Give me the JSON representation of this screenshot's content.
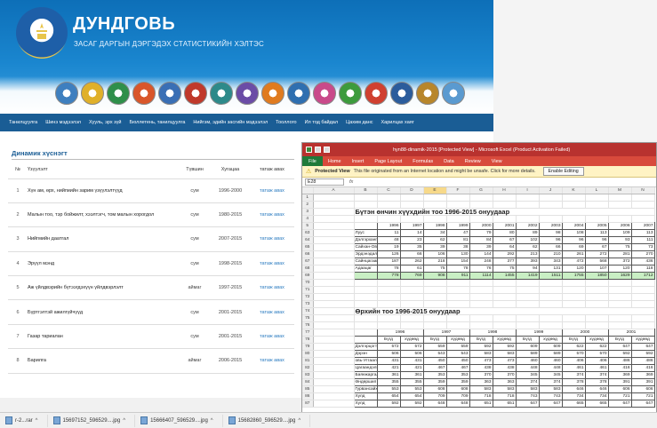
{
  "site": {
    "title": "ДУНДГОВЬ",
    "subtitle": "ЗАСАГ ДАРГЫН ДЭРГЭДЭХ СТАТИСТИКИЙН ХЭЛТЭС",
    "logo_colors": [
      "#3e7fbf",
      "#e0b02a",
      "#2f8f4a",
      "#d9562a",
      "#3a6fb5",
      "#c0392b",
      "#2d8a8a",
      "#6b4ca6",
      "#e07b1f",
      "#2f6fb0",
      "#c94a8a",
      "#3d9b3d",
      "#d04030",
      "#2b5c9c",
      "#b8862b",
      "#5a9ad0"
    ]
  },
  "nav": [
    "Танилцуулга",
    "Шинэ мэдээлэл",
    "Хууль, эрх зүй",
    "Бюллетень, танилцуулга",
    "Нийгэм, эдийн засгийн мэдээлэл",
    "Тооллого",
    "Ил тод байдал",
    "Цахим данс",
    "Харилцах хаяг"
  ],
  "dynamic": {
    "title": "Динамик хүснэгт",
    "headers": [
      "№",
      "Үзүүлэлт",
      "Түвшин",
      "Хугацаа",
      "татаж авах"
    ],
    "rows": [
      {
        "n": "1",
        "name": "Хүн ам, өрх, нийгмийн зарим үзүүлэлтүүд",
        "unit": "сум",
        "period": "1996-2000",
        "link": "татаж авах"
      },
      {
        "n": "2",
        "name": "Малын тоо, тэр бойжилт, хээлтэгч, том малын хорогдол",
        "unit": "сум",
        "period": "1980-2015",
        "link": "татаж авах"
      },
      {
        "n": "3",
        "name": "Нийгмийн даатгал",
        "unit": "сум",
        "period": "2007-2015",
        "link": "татаж авах"
      },
      {
        "n": "4",
        "name": "Эрүүл мэнд",
        "unit": "сум",
        "period": "1998-2015",
        "link": "татаж авах"
      },
      {
        "n": "5",
        "name": "Аж үйлдвэрийн бүтээгдэхүүн үйлдвэрлэлт",
        "unit": "аймаг",
        "period": "1997-2015",
        "link": "татаж авах"
      },
      {
        "n": "6",
        "name": "Бүртгэлтэй ажилгүйчүүд",
        "unit": "сум",
        "period": "2001-2015",
        "link": "татаж авах"
      },
      {
        "n": "7",
        "name": "Газар тариалан",
        "unit": "сум",
        "period": "2001-2015",
        "link": "татаж авах"
      },
      {
        "n": "8",
        "name": "Барилга",
        "unit": "аймаг",
        "period": "2006-2015",
        "link": "татаж авах"
      }
    ]
  },
  "excel": {
    "title": "hyn88-dinamik-2015 [Protected View] - Microsoft Excel (Product Activation Failed)",
    "file_tab": "File",
    "tabs": [
      "Home",
      "Insert",
      "Page Layout",
      "Formulas",
      "Data",
      "Review",
      "View"
    ],
    "protected_label": "Protected View",
    "protected_msg": "This file originated from an Internet location and might be unsafe. Click for more details.",
    "enable_btn": "Enable Editing",
    "cell_ref": "E28",
    "fx": "fx",
    "columns": [
      "A",
      "B",
      "C",
      "D",
      "E",
      "F",
      "G",
      "H",
      "I",
      "J",
      "K",
      "L",
      "M",
      "N"
    ],
    "heading1": "Бүтэн өнчин хүүхдийн тоо 1996-2015 онуудаар",
    "heading2": "Өрхийн тоо 1996-2015 онуудаар",
    "years1": [
      "1996",
      "1997",
      "1998",
      "1999",
      "2000",
      "2001",
      "2002",
      "2003",
      "2004",
      "2005",
      "2006",
      "2007",
      "2008"
    ],
    "table1": [
      {
        "r": "63",
        "name": "Луус",
        "v": [
          "11",
          "14",
          "34",
          "47",
          "79",
          "80",
          "89",
          "98",
          "108",
          "113",
          "109",
          "113",
          "120"
        ]
      },
      {
        "r": "64",
        "name": "Дэлгэрхангай",
        "v": [
          "48",
          "23",
          "62",
          "81",
          "84",
          "67",
          "102",
          "96",
          "96",
          "96",
          "93",
          "111",
          "126"
        ]
      },
      {
        "r": "65",
        "name": "Сайхан-Овоо",
        "v": [
          "19",
          "35",
          "39",
          "38",
          "39",
          "64",
          "62",
          "66",
          "69",
          "67",
          "75",
          "73",
          "24"
        ]
      },
      {
        "r": "66",
        "name": "Эрдэнэдалай",
        "v": [
          "126",
          "66",
          "106",
          "130",
          "144",
          "292",
          "213",
          "210",
          "261",
          "272",
          "281",
          "270",
          "261"
        ]
      },
      {
        "r": "67",
        "name": "Сайнцагаан",
        "v": [
          "187",
          "262",
          "218",
          "154",
          "248",
          "377",
          "393",
          "343",
          "472",
          "568",
          "372",
          "436",
          "698"
        ]
      },
      {
        "r": "68",
        "name": "Адаацаг",
        "v": [
          "78",
          "61",
          "75",
          "78",
          "76",
          "75",
          "94",
          "131",
          "120",
          "107",
          "120",
          "118",
          "138"
        ]
      },
      {
        "r": "69",
        "name": "",
        "v": [
          "778",
          "769",
          "908",
          "911",
          "1114",
          "1455",
          "1419",
          "1511",
          "1755",
          "1850",
          "1629",
          "1712",
          "2012"
        ]
      }
    ],
    "years2": [
      "1996",
      "1997",
      "1998",
      "1999",
      "2000",
      "2001"
    ],
    "sub2": [
      "Бүгд",
      "хүдөөд"
    ],
    "table2": [
      {
        "r": "79",
        "name": "Дэлгэрцогт",
        "v": [
          "572",
          "572",
          "559",
          "559",
          "592",
          "592",
          "609",
          "609",
          "622",
          "622",
          "647",
          "647",
          "632"
        ]
      },
      {
        "r": "80",
        "name": "Дэрэн",
        "v": [
          "506",
          "506",
          "543",
          "543",
          "583",
          "583",
          "589",
          "589",
          "570",
          "570",
          "592",
          "592",
          "583"
        ]
      },
      {
        "r": "81",
        "name": "овь-Угтаал",
        "v": [
          "431",
          "431",
          "450",
          "450",
          "473",
          "473",
          "460",
          "460",
          "406",
          "406",
          "486",
          "486",
          "424"
        ]
      },
      {
        "r": "82",
        "name": "Цагаандэлгэр",
        "v": [
          "421",
          "421",
          "467",
          "467",
          "438",
          "438",
          "448",
          "448",
          "461",
          "461",
          "416",
          "416",
          "418"
        ]
      },
      {
        "r": "83",
        "name": "Баянжаргалан",
        "v": [
          "361",
          "361",
          "353",
          "353",
          "370",
          "370",
          "345",
          "345",
          "374",
          "374",
          "369",
          "369",
          "369"
        ]
      },
      {
        "r": "84",
        "name": "Өндөршил",
        "v": [
          "355",
          "355",
          "359",
          "359",
          "363",
          "363",
          "374",
          "374",
          "378",
          "378",
          "391",
          "391",
          "397"
        ]
      },
      {
        "r": "85",
        "name": "Гурвансайхан",
        "v": [
          "553",
          "553",
          "608",
          "608",
          "583",
          "583",
          "583",
          "583",
          "646",
          "646",
          "606",
          "606",
          "629"
        ]
      },
      {
        "r": "86",
        "name": "Хулд",
        "v": [
          "654",
          "654",
          "709",
          "709",
          "718",
          "718",
          "743",
          "743",
          "734",
          "734",
          "721",
          "721",
          "745"
        ]
      },
      {
        "r": "87",
        "name": "Хулд",
        "v": [
          "592",
          "592",
          "648",
          "648",
          "651",
          "651",
          "647",
          "647",
          "665",
          "665",
          "647",
          "647",
          "634"
        ]
      }
    ]
  },
  "taskbar": [
    {
      "label": "r-2...rar"
    },
    {
      "label": "15697152_596529....jpg"
    },
    {
      "label": "15666407_596529....jpg"
    },
    {
      "label": "15682860_596529....jpg"
    }
  ]
}
